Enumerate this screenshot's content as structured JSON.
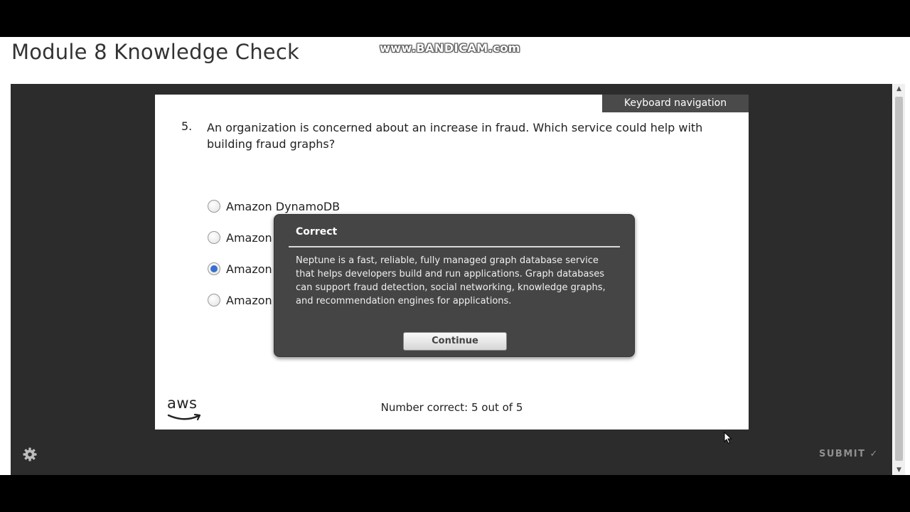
{
  "page": {
    "title": "Module 8 Knowledge Check",
    "watermark": "www.BANDICAM.com"
  },
  "slide": {
    "keyboard_navigation": "Keyboard navigation",
    "question_number": "5.",
    "question_text": "An organization is concerned about an increase in fraud. Which service could help with building fraud graphs?",
    "options": [
      {
        "label": "Amazon DynamoDB",
        "selected": false
      },
      {
        "label": "Amazon",
        "selected": false
      },
      {
        "label": "Amazon",
        "selected": true
      },
      {
        "label": "Amazon",
        "selected": false
      }
    ],
    "logo_text": "aws",
    "score_text": "Number correct: 5 out of 5"
  },
  "modal": {
    "title": "Correct",
    "body": "Neptune is a fast, reliable, fully managed graph database service that helps developers build and run applications. Graph databases can support fraud detection, social networking, knowledge graphs, and recommendation engines for applications.",
    "continue_label": "Continue"
  },
  "player_bar": {
    "submit_label": "SUBMIT",
    "submit_icon": "check-icon",
    "settings_icon": "gear-icon"
  },
  "colors": {
    "player_background": "#2c2c2c",
    "modal_background": "#454545",
    "radio_selected": "#3a6fd1"
  }
}
